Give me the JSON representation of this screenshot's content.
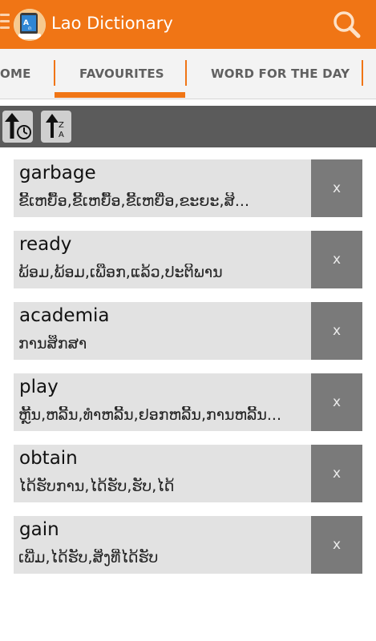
{
  "app": {
    "title": "Lao Dictionary",
    "logo_badge": "offline"
  },
  "tabs": [
    {
      "label": "OME"
    },
    {
      "label": "FAVOURITES",
      "selected": true
    },
    {
      "label": "WORD FOR THE DAY"
    }
  ],
  "toolbar": {
    "sort_time_icon": "sort-by-time-icon",
    "sort_alpha_icon": "sort-alphabetical-icon",
    "sort_alpha_letters": {
      "top": "Z",
      "bottom": "A"
    }
  },
  "favourites": [
    {
      "word": "garbage",
      "translation": "ຂີ້ເຫຍື້ອ,ຂີ້ເຫຍື້ອ,ຂີ້ເຫຍື່ອ,ຂະຍະ,ສິ...",
      "delete_label": "x"
    },
    {
      "word": "ready",
      "translation": "ພ້ອມ,ພ້ອມ,ເພືອກ,ແລ້ວ,ປະຕິພານ",
      "delete_label": "x"
    },
    {
      "word": "academia",
      "translation": "ການສຶກສາ",
      "delete_label": "x"
    },
    {
      "word": "play",
      "translation": "ຫຼີ້ນ,ຫລີ້ນ,ທຳຫລີ້ນ,ຢອກຫລີ້ນ,ການຫລີ້ນ...",
      "delete_label": "x"
    },
    {
      "word": "obtain",
      "translation": "ໄດ້ຮັບການ,ໄດ້ຮັບ,ຮັບ,ໄດ້",
      "delete_label": "x"
    },
    {
      "word": "gain",
      "translation": "ເພີ່ມ,ໄດ້ຮັບ,ສິ່ງທີ່ໄດ້ຮັບ",
      "delete_label": "x"
    }
  ],
  "colors": {
    "app_bar": "#f07515",
    "tab_accent": "#f07515",
    "toolbar": "#5b5b5b",
    "item_bg": "#e2e2e2",
    "delete_bg": "#7a7a7a"
  }
}
